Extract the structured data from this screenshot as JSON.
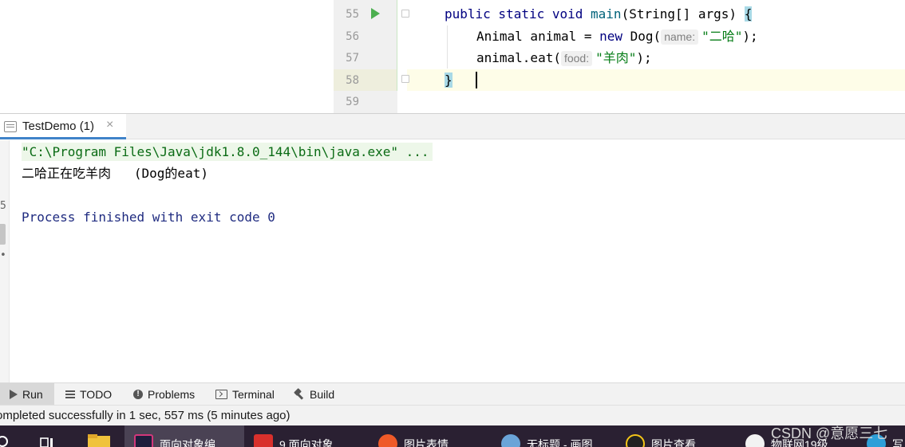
{
  "editor": {
    "line_numbers": [
      "55",
      "56",
      "57",
      "58",
      "59"
    ],
    "lines": [
      {
        "parts": [
          {
            "t": "public static void ",
            "c": "kw"
          },
          {
            "t": "main",
            "c": "fn"
          },
          {
            "t": "(String[] args) ",
            "c": ""
          },
          {
            "t": "{",
            "c": "brace-hl"
          }
        ]
      },
      {
        "parts": [
          {
            "t": "Animal animal = ",
            "c": ""
          },
          {
            "t": "new ",
            "c": "kw"
          },
          {
            "t": "Dog(",
            "c": ""
          },
          {
            "t": "name:",
            "c": "hint"
          },
          {
            "t": "\"二哈\"",
            "c": "str"
          },
          {
            "t": ");",
            "c": ""
          }
        ]
      },
      {
        "parts": [
          {
            "t": "animal.eat(",
            "c": ""
          },
          {
            "t": "food:",
            "c": "hint"
          },
          {
            "t": "\"羊肉\"",
            "c": "str"
          },
          {
            "t": ");",
            "c": ""
          }
        ]
      },
      {
        "parts": [
          {
            "t": "}",
            "c": "brace-hl"
          }
        ]
      }
    ]
  },
  "run_panel": {
    "tab_label": "TestDemo (1)",
    "tab_close": "×",
    "gutter_chars": [
      "5",
      "•"
    ],
    "console": {
      "command": "\"C:\\Program Files\\Java\\jdk1.8.0_144\\bin\\java.exe\" ...",
      "output": "二哈正在吃羊肉   (Dog的eat)",
      "exit": "Process finished with exit code 0"
    }
  },
  "tool_windows": [
    {
      "label": "Run",
      "icon": "run-icon",
      "active": true
    },
    {
      "label": "TODO",
      "icon": "todo-icon",
      "active": false
    },
    {
      "label": "Problems",
      "icon": "problems-icon",
      "active": false
    },
    {
      "label": "Terminal",
      "icon": "terminal-icon",
      "active": false
    },
    {
      "label": "Build",
      "icon": "build-icon",
      "active": false
    }
  ],
  "status": {
    "text": "ompleted successfully in 1 sec, 557 ms (5 minutes ago)"
  },
  "taskbar": {
    "items": [
      {
        "label": "面向对象编",
        "icon": "intellij-icon",
        "color": "#1e1e3c",
        "active": true
      },
      {
        "label": "9.面向对象",
        "icon": "wps-icon",
        "color": "#d9302c",
        "active": false
      },
      {
        "label": "图片表情",
        "icon": "sogou-icon",
        "color": "#ef5a28",
        "active": false
      },
      {
        "label": "无标题 - 画图",
        "icon": "paint-icon",
        "color": "#6aa4d8",
        "active": false
      },
      {
        "label": "图片查看",
        "icon": "qq-icon",
        "color": "#222222",
        "active": false
      },
      {
        "label": "物联网19级",
        "icon": "chat-icon",
        "color": "#f2f2f2",
        "active": false
      },
      {
        "label": "写",
        "icon": "edge-icon",
        "color": "#2d9fd8",
        "active": false
      }
    ],
    "watermark": "CSDN @意愿三七"
  },
  "colors": {
    "run_arrow": "#4caf50",
    "tab_underline": "#4083c9",
    "keyword": "#000080",
    "string": "#067d17"
  }
}
